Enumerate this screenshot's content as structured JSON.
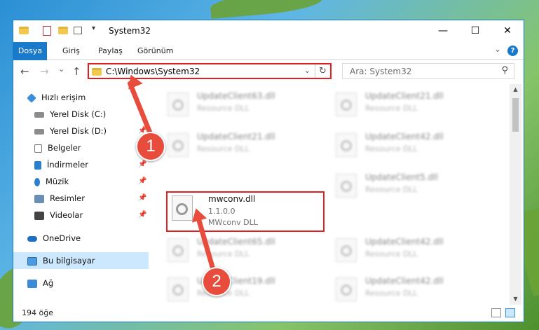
{
  "window": {
    "title": "System32",
    "minimize_glyph": "—",
    "maximize_glyph": "☐",
    "close_glyph": "✕"
  },
  "ribbon": {
    "tabs": [
      "Dosya",
      "Giriş",
      "Paylaş",
      "Görünüm"
    ],
    "help_glyph": "?",
    "collapse_glyph": "⌄"
  },
  "nav": {
    "address_path": "C:\\Windows\\System32",
    "search_placeholder": "Ara: System32",
    "back_glyph": "←",
    "forward_glyph": "→",
    "recent_glyph": "⌄",
    "up_glyph": "↑",
    "dropdown_glyph": "⌄",
    "refresh_glyph": "↻",
    "search_glyph": "⚲"
  },
  "sidebar": {
    "items": [
      {
        "label": "Hızlı erişim",
        "icon": "star-icon",
        "pinned": false
      },
      {
        "label": "Yerel Disk (C:)",
        "icon": "drive-icon",
        "pinned": true
      },
      {
        "label": "Yerel Disk (D:)",
        "icon": "drive-icon",
        "pinned": true
      },
      {
        "label": "Belgeler",
        "icon": "documents-icon",
        "pinned": true
      },
      {
        "label": "İndirmeler",
        "icon": "download-icon",
        "pinned": true
      },
      {
        "label": "Müzik",
        "icon": "music-icon",
        "pinned": true
      },
      {
        "label": "Resimler",
        "icon": "pictures-icon",
        "pinned": true
      },
      {
        "label": "Videolar",
        "icon": "videos-icon",
        "pinned": true
      },
      {
        "label": "OneDrive",
        "icon": "cloud-icon",
        "pinned": false
      },
      {
        "label": "Bu bilgisayar",
        "icon": "computer-icon",
        "pinned": false
      },
      {
        "label": "Ağ",
        "icon": "network-icon",
        "pinned": false
      }
    ],
    "pin_glyph": "📌"
  },
  "files": {
    "left_column": [
      {
        "name": "UpdateClient63.dll",
        "type": "Resource DLL"
      },
      {
        "name": "UpdateClient21.dll",
        "type": "Resource DLL"
      },
      {
        "name": "UpdateClient65.dll",
        "type": "Resource DLL"
      },
      {
        "name": "UpdateClient19.dll",
        "type": "Resource DLL"
      }
    ],
    "right_column": [
      {
        "name": "UpdateClient21.dll",
        "type": "Resource DLL"
      },
      {
        "name": "UpdateClient42.dll",
        "type": "Resource DLL"
      },
      {
        "name": "UpdateClient5.dll",
        "type": "Resource DLL"
      },
      {
        "name": "UpdateClient42.dll",
        "type": "Resource DLL"
      },
      {
        "name": "UpdateClient42.dll",
        "type": "Resource DLL"
      }
    ],
    "selected": {
      "name": "mwconv.dll",
      "version": "1.1.0.0",
      "description": "MWconv DLL"
    }
  },
  "status": {
    "item_count": "194 öğe"
  },
  "callouts": {
    "one": "1",
    "two": "2"
  },
  "colors": {
    "accent": "#1979ca",
    "highlight": "#e02020",
    "callout": "#e74c3c"
  }
}
